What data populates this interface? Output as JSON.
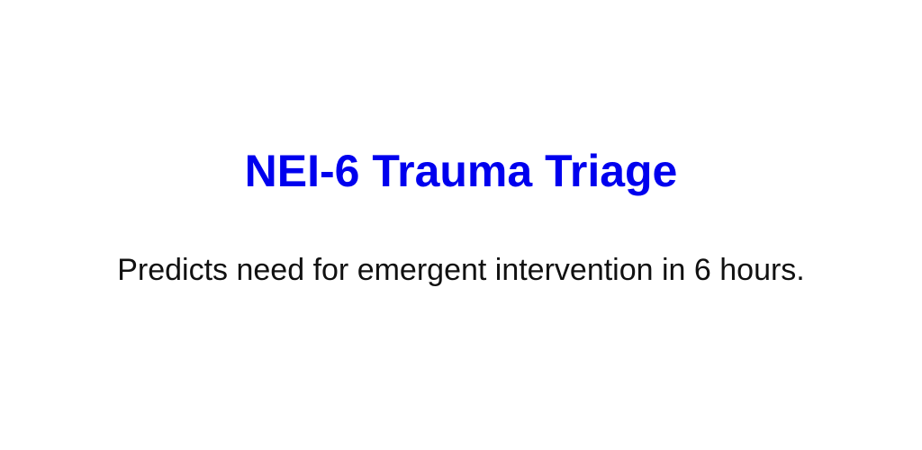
{
  "app": {
    "title": "NEI-6 Trauma Triage",
    "description": "Predicts need for emergent intervention in 6 hours."
  },
  "colors": {
    "title": "#0000ee",
    "description": "#111111",
    "background": "#ffffff"
  }
}
